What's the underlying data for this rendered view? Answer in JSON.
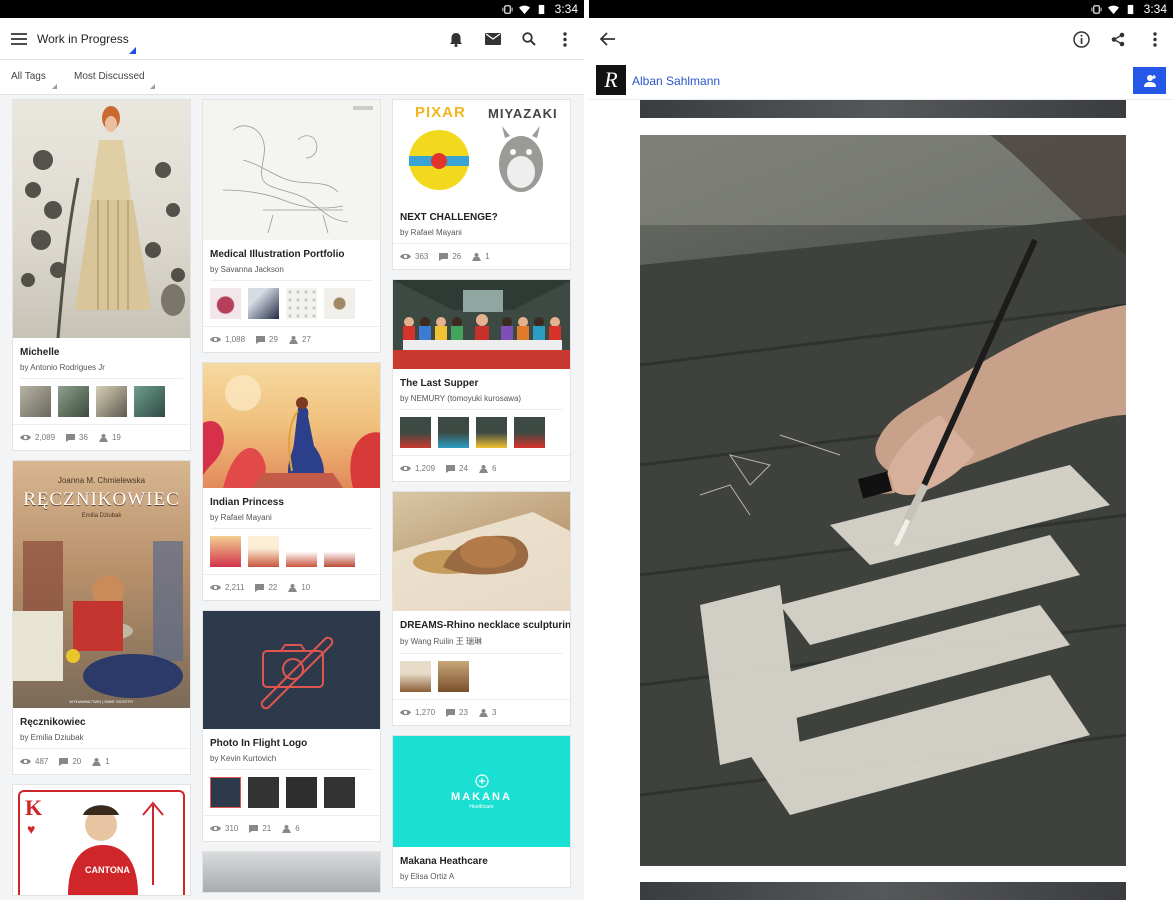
{
  "status": {
    "time": "3:34"
  },
  "left": {
    "appbar": {
      "title": "Work in Progress"
    },
    "filters": {
      "tags": "All Tags",
      "sort": "Most Discussed"
    },
    "columns": [
      [
        {
          "title": "Michelle",
          "author": "by Antonio Rodrigues Jr",
          "views": "2,089",
          "comments": "36",
          "likes": "19"
        },
        {
          "title": "Ręcznikowiec",
          "author": "by Emilia Dziubak",
          "views": "487",
          "comments": "20",
          "likes": "1",
          "cover_line1": "Joanna M. Chmielewska",
          "cover_title": "RĘCZNIKOWIEC",
          "cover_line2": "Emilia Dziubak",
          "cover_footer": "WYDAWNICTWO | DWIE SIOSTRY"
        },
        {
          "card_letter": "K",
          "shirt_text": "CANTONA"
        }
      ],
      [
        {
          "title": "Medical Illustration Portfolio",
          "author": "by Savanna Jackson",
          "views": "1,088",
          "comments": "29",
          "likes": "27"
        },
        {
          "title": "Indian Princess",
          "author": "by Rafael Mayani",
          "views": "2,211",
          "comments": "22",
          "likes": "10"
        },
        {
          "title": "Photo In Flight Logo",
          "author": "by Kevin Kurtovich",
          "views": "310",
          "comments": "21",
          "likes": "6"
        }
      ],
      [
        {
          "title": "NEXT CHALLENGE?",
          "author": "by Rafael Mayani",
          "views": "363",
          "comments": "26",
          "likes": "1",
          "art_left": "PIXAR",
          "art_right": "MIYAZAKI"
        },
        {
          "title": "The Last Supper",
          "author": "by NEMURY (tomoyuki kurosawa)",
          "views": "1,209",
          "comments": "24",
          "likes": "6"
        },
        {
          "title": "DREAMS-Rhino necklace sculpturing",
          "author": "by Wang Ruilin 王 瑞琳",
          "views": "1,270",
          "comments": "23",
          "likes": "3"
        },
        {
          "title": "Makana Heathcare",
          "author": "by Elisa Ortiz A",
          "art_brand": "MAKANA",
          "art_sub": "Healthcare"
        }
      ]
    ]
  },
  "right": {
    "author": {
      "name": "Alban Sahlmann",
      "logo_letter": "R"
    }
  },
  "icons": {
    "menu": "menu-icon",
    "bell": "notifications-icon",
    "mail": "mail-icon",
    "search": "search-icon",
    "more": "more-vert-icon",
    "back": "back-arrow-icon",
    "info": "info-icon",
    "share": "share-icon",
    "follow": "add-person-icon",
    "views": "eye-icon",
    "comments": "comment-icon",
    "likes": "appreciate-icon"
  },
  "colors": {
    "accent": "#1f4fe0",
    "follow_button": "#2558e8",
    "author_link": "#2a55c8",
    "makana": "#19e0d3",
    "photo_logo_bg": "#2c3a4c"
  }
}
